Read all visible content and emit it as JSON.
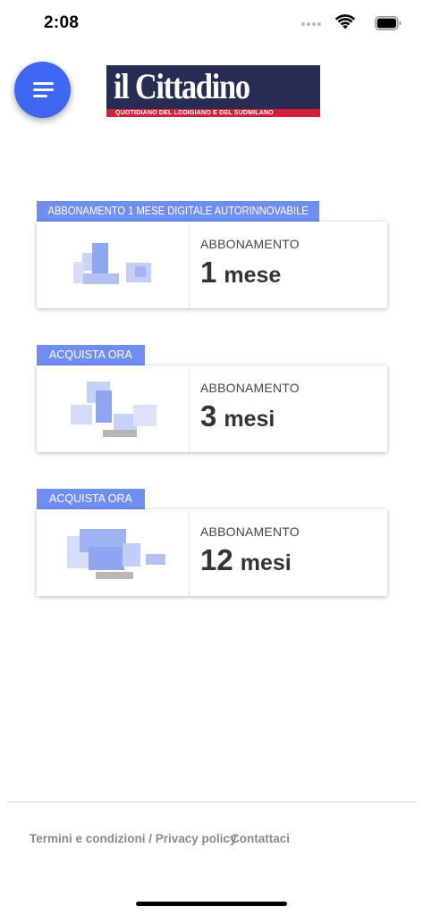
{
  "status_bar": {
    "time": "2:08",
    "icons": [
      "signal-dots-icon",
      "wifi-icon",
      "battery-icon"
    ]
  },
  "header": {
    "menu_icon": "hamburger-menu-icon",
    "logo": {
      "title": "il Cittadino",
      "subtitle": "QUOTIDIANO DEL LODIGIANO E DEL SUDMILANO"
    }
  },
  "offers": [
    {
      "tag": "ABBONAMENTO 1 MESE DIGITALE AUTORINNOVABILE",
      "label": "ABBONAMENTO",
      "number": "1",
      "unit": "mese"
    },
    {
      "tag": "ACQUISTA ORA",
      "label": "ABBONAMENTO",
      "number": "3",
      "unit": "mesi"
    },
    {
      "tag": "ACQUISTA ORA",
      "label": "ABBONAMENTO",
      "number": "12",
      "unit": "mesi"
    }
  ],
  "footer": {
    "terms": "Termini e condizioni / Privacy policy",
    "contact": "Contattaci"
  },
  "colors": {
    "accent": "#3d66f3",
    "tag": "#6f8ef4",
    "logo_bg": "#272c53",
    "logo_strip": "#d3203a"
  }
}
